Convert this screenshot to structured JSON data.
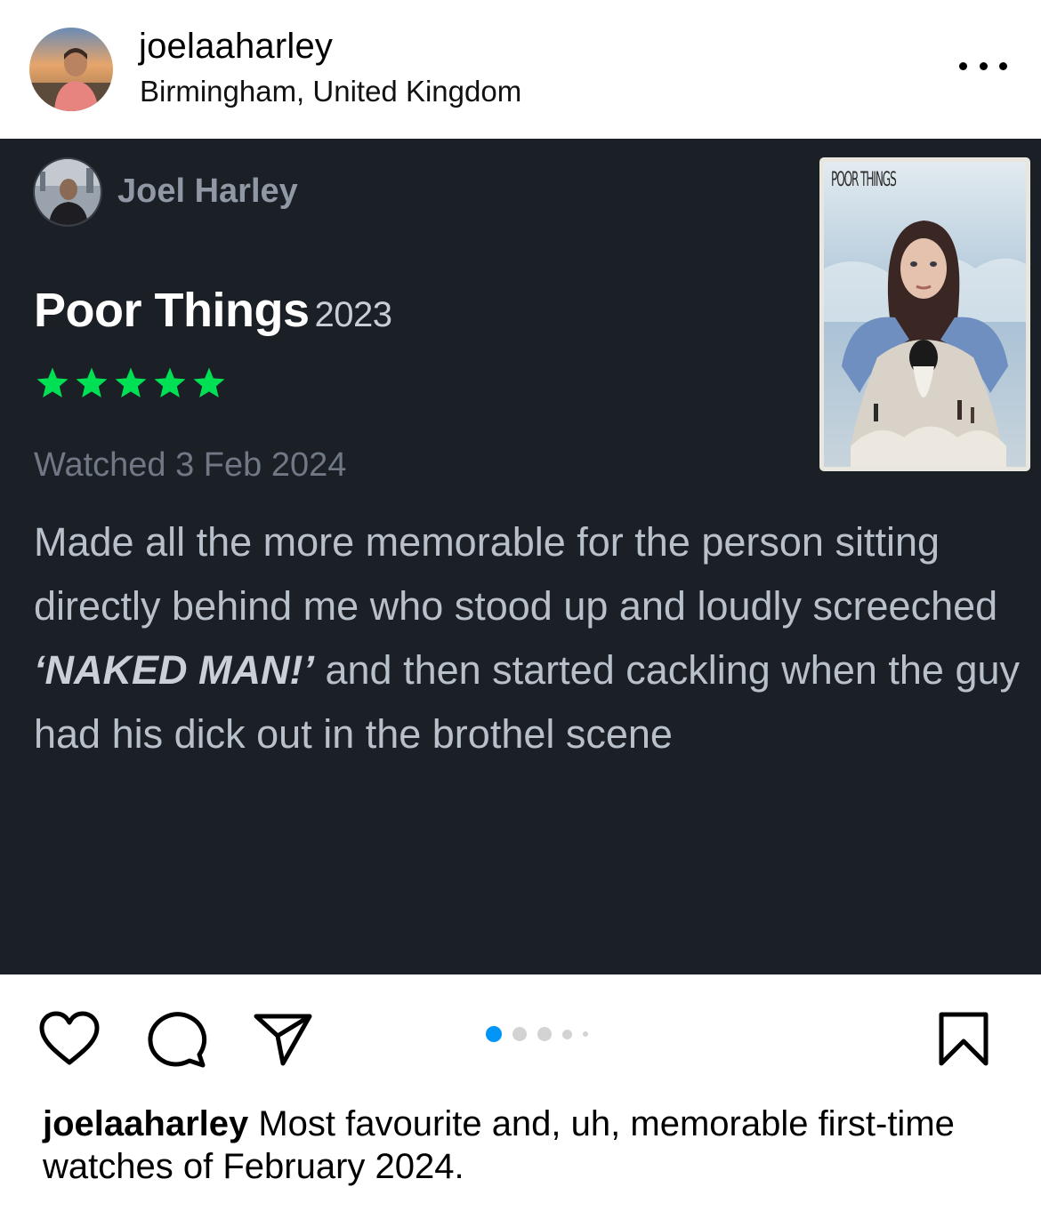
{
  "post": {
    "username": "joelaaharley",
    "location": "Birmingham, United Kingdom"
  },
  "review_card": {
    "reviewer_name": "Joel Harley",
    "film_title": "Poor Things",
    "film_year": "2023",
    "rating_stars": 5,
    "star_color": "#00e054",
    "watched": "Watched 3 Feb 2024",
    "review_before": "Made all the more memorable for the person sitting directly behind me who stood up and loudly screeched ",
    "review_emphasis": "‘NAKED MAN!’",
    "review_after": " and then started cackling when the guy had his dick out in the brothel scene",
    "poster_title": "POOR THINGS"
  },
  "carousel": {
    "total": 5,
    "active_index": 0,
    "active_color": "#0095f6"
  },
  "caption": {
    "username": "joelaaharley",
    "text": " Most favourite and, uh, memorable first-time watches of February 2024."
  },
  "icons": {
    "like": "heart-icon",
    "comment": "comment-icon",
    "share": "paper-plane-icon",
    "save": "bookmark-icon",
    "more": "more-dots-icon"
  }
}
